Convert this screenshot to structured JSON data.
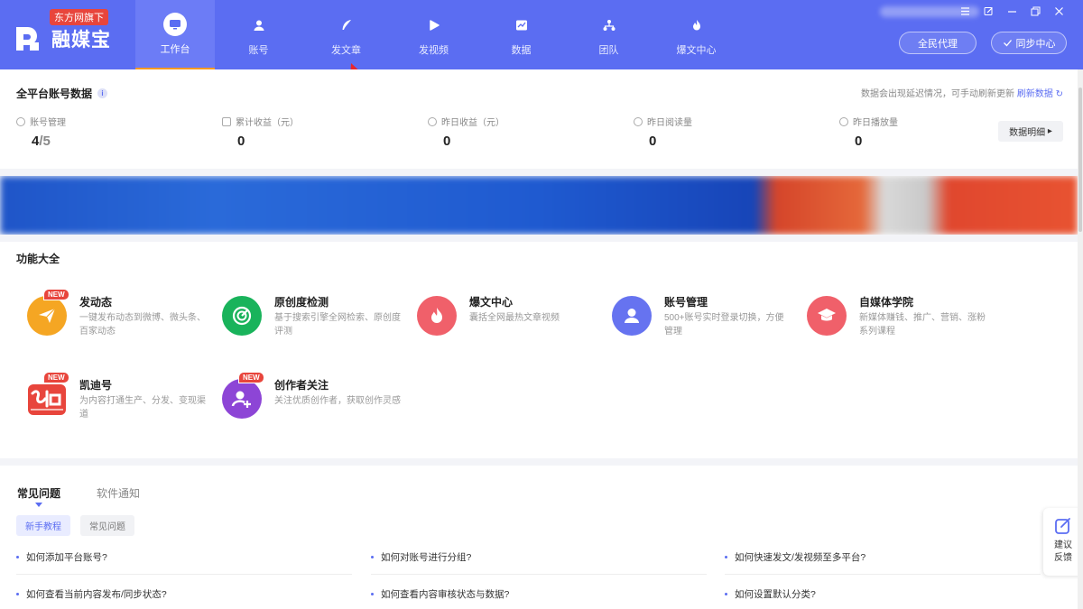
{
  "app": {
    "badge": "东方网旗下",
    "name": "融媒宝"
  },
  "nav": [
    {
      "label": "工作台",
      "icon": "monitor-icon",
      "active": true
    },
    {
      "label": "账号",
      "icon": "user-icon",
      "active": false
    },
    {
      "label": "发文章",
      "icon": "feather-icon",
      "active": false
    },
    {
      "label": "发视频",
      "icon": "play-icon",
      "active": false
    },
    {
      "label": "数据",
      "icon": "chart-icon",
      "active": false
    },
    {
      "label": "团队",
      "icon": "team-icon",
      "active": false
    },
    {
      "label": "爆文中心",
      "icon": "flame-icon",
      "active": false
    }
  ],
  "header_buttons": {
    "agent": "全民代理",
    "sync": "同步中心"
  },
  "stats": {
    "title": "全平台账号数据",
    "notice": "数据会出现延迟情况，可手动刷新更新",
    "refresh": "刷新数据",
    "detail_button": "数据明细",
    "items": [
      {
        "label": "账号管理",
        "value": "4",
        "suffix": "/5"
      },
      {
        "label": "累计收益（元）",
        "value": "0"
      },
      {
        "label": "昨日收益（元）",
        "value": "0"
      },
      {
        "label": "昨日阅读量",
        "value": "0"
      },
      {
        "label": "昨日播放量",
        "value": "0"
      }
    ]
  },
  "features": {
    "title": "功能大全",
    "new_badge": "NEW",
    "items": [
      {
        "name": "发动态",
        "desc": "一键发布动态到微博、微头条、百家动态",
        "icon": "paper-plane-icon",
        "color": "#f5a623",
        "new": true
      },
      {
        "name": "原创度检测",
        "desc": "基于搜索引擎全网检索、原创度评测",
        "icon": "radar-icon",
        "color": "#19b35b",
        "new": false
      },
      {
        "name": "爆文中心",
        "desc": "囊括全网最热文章视频",
        "icon": "flame-icon",
        "color": "#f0606a",
        "new": false
      },
      {
        "name": "账号管理",
        "desc": "500+账号实时登录切换，方便管理",
        "icon": "person-icon",
        "color": "#6673f0",
        "new": false
      },
      {
        "name": "自媒体学院",
        "desc": "新媒体赚钱、推广、营销、涨粉系列课程",
        "icon": "graduation-cap-icon",
        "color": "#f0606a",
        "new": false
      },
      {
        "name": "凯迪号",
        "desc": "为内容打通生产、分发、变现渠道",
        "icon": "kaidi-logo-icon",
        "color": "#e8453c",
        "new": true
      },
      {
        "name": "创作者关注",
        "desc": "关注优质创作者，获取创作灵感",
        "icon": "user-plus-icon",
        "color": "#8d45d6",
        "new": true
      }
    ]
  },
  "faq": {
    "tabs": [
      "常见问题",
      "软件通知"
    ],
    "pills": [
      "新手教程",
      "常见问题"
    ],
    "questions": [
      "如何添加平台账号?",
      "如何对账号进行分组?",
      "如何快速发文/发视频至多平台?",
      "如何查看当前内容发布/同步状态?",
      "如何查看内容审核状态与数据?",
      "如何设置默认分类?"
    ]
  },
  "feedback": {
    "label": "建议反馈"
  }
}
